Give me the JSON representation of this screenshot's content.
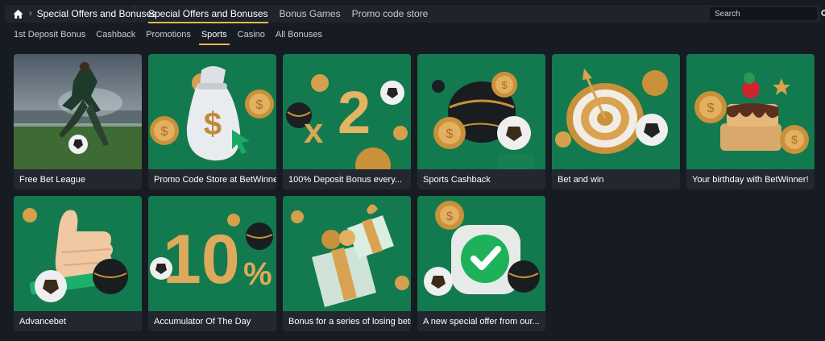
{
  "header": {
    "breadcrumb_label": "Special Offers and Bonuses",
    "tabs": [
      {
        "label": "Special Offers and Bonuses",
        "active": true
      },
      {
        "label": "Bonus Games",
        "active": false
      },
      {
        "label": "Promo code store",
        "active": false
      }
    ],
    "search_placeholder": "Search"
  },
  "subnav": [
    {
      "label": "1st Deposit Bonus",
      "active": false
    },
    {
      "label": "Cashback",
      "active": false
    },
    {
      "label": "Promotions",
      "active": false
    },
    {
      "label": "Sports",
      "active": true
    },
    {
      "label": "Casino",
      "active": false
    },
    {
      "label": "All Bonuses",
      "active": false
    }
  ],
  "cards": [
    {
      "title": "Free Bet League",
      "image": "soccer-stadium-image"
    },
    {
      "title": "Promo Code Store at BetWinner",
      "image": "money-bag-image"
    },
    {
      "title": "100% Deposit Bonus every...",
      "image": "x2-multiplier-image"
    },
    {
      "title": "Sports Cashback",
      "image": "sports-balls-image"
    },
    {
      "title": "Bet and win",
      "image": "target-dart-image"
    },
    {
      "title": "Your birthday with BetWinner!",
      "image": "birthday-cake-image"
    },
    {
      "title": "Advancebet",
      "image": "thumbs-up-image"
    },
    {
      "title": "Accumulator Of The Day",
      "image": "ten-percent-image"
    },
    {
      "title": "Bonus for a series of losing bets",
      "image": "gift-box-image"
    },
    {
      "title": "A new special offer from our...",
      "image": "checkmark-image"
    }
  ],
  "colors": {
    "accent": "#f0b84a",
    "card_green": "#0f7a4c",
    "background": "#171b22"
  }
}
